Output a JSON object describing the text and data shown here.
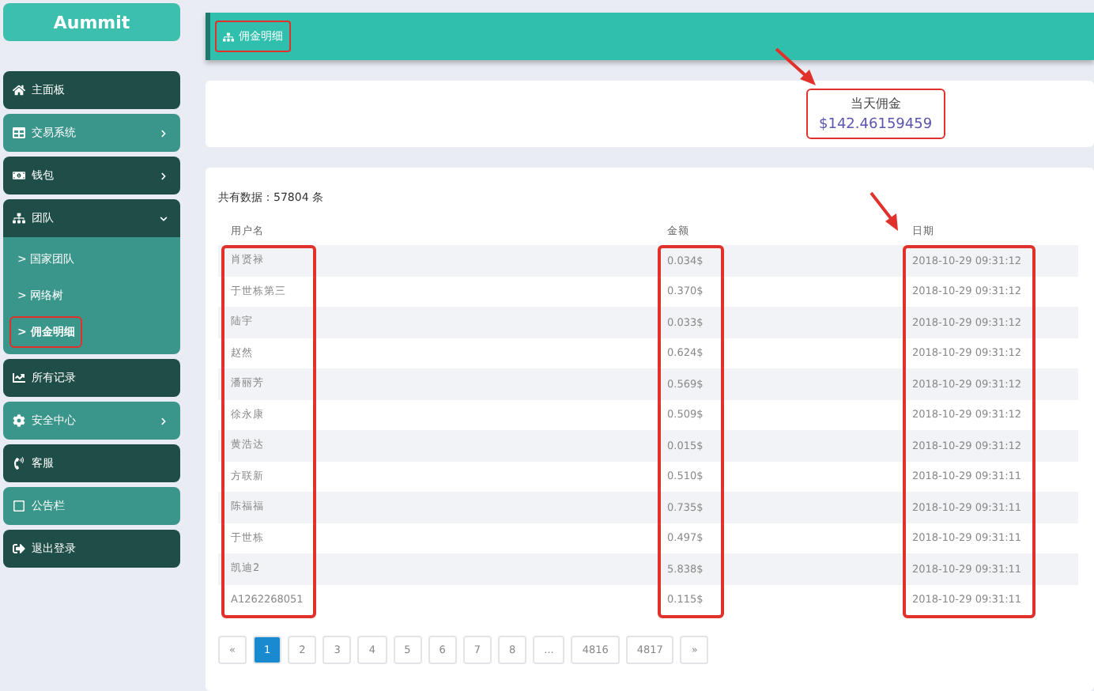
{
  "logo": "Aummit",
  "sidebar": {
    "items": [
      {
        "label": "主面板",
        "has_submenu": false,
        "expanded": false
      },
      {
        "label": "交易系统",
        "has_submenu": true,
        "expanded": false
      },
      {
        "label": "钱包",
        "has_submenu": true,
        "expanded": false
      },
      {
        "label": "团队",
        "has_submenu": true,
        "expanded": true,
        "children": [
          {
            "caret": ">",
            "label": "国家团队",
            "selected": false,
            "highlighted": false
          },
          {
            "caret": ">",
            "label": "网络树",
            "selected": false,
            "highlighted": false
          },
          {
            "caret": ">",
            "label": "佣金明细",
            "selected": true,
            "highlighted": true
          }
        ]
      },
      {
        "label": "所有记录",
        "has_submenu": false,
        "expanded": false
      },
      {
        "label": "安全中心",
        "has_submenu": true,
        "expanded": false
      },
      {
        "label": "客服",
        "has_submenu": false,
        "expanded": false
      },
      {
        "label": "公告栏",
        "has_submenu": false,
        "expanded": false
      },
      {
        "label": "退出登录",
        "has_submenu": false,
        "expanded": false
      }
    ]
  },
  "header": {
    "title": "佣金明细",
    "highlighted": true
  },
  "stat": {
    "label": "当天佣金",
    "value": "$142.46159459",
    "highlighted": true
  },
  "table": {
    "total": "共有数据：57804 条",
    "columns": [
      {
        "label": "用户名",
        "highlighted": true
      },
      {
        "label": "金额",
        "highlighted": true
      },
      {
        "label": "日期",
        "highlighted": true
      }
    ],
    "rows": [
      [
        "肖贤禄",
        "0.034$",
        "2018-10-29 09:31:12"
      ],
      [
        "于世栋第三",
        "0.370$",
        "2018-10-29 09:31:12"
      ],
      [
        "陆宇",
        "0.033$",
        "2018-10-29 09:31:12"
      ],
      [
        "赵然",
        "0.624$",
        "2018-10-29 09:31:12"
      ],
      [
        "潘丽芳",
        "0.569$",
        "2018-10-29 09:31:12"
      ],
      [
        "徐永康",
        "0.509$",
        "2018-10-29 09:31:12"
      ],
      [
        "黄浩达",
        "0.015$",
        "2018-10-29 09:31:12"
      ],
      [
        "方联新",
        "0.510$",
        "2018-10-29 09:31:11"
      ],
      [
        "陈福福",
        "0.735$",
        "2018-10-29 09:31:11"
      ],
      [
        "于世栋",
        "0.497$",
        "2018-10-29 09:31:11"
      ],
      [
        "凯迪2",
        "5.838$",
        "2018-10-29 09:31:11"
      ],
      [
        "A1262268051",
        "0.115$",
        "2018-10-29 09:31:11"
      ]
    ]
  },
  "pagination": [
    {
      "label": "«",
      "selected": false
    },
    {
      "label": "1",
      "selected": true
    },
    {
      "label": "2",
      "selected": false
    },
    {
      "label": "3",
      "selected": false
    },
    {
      "label": "4",
      "selected": false
    },
    {
      "label": "5",
      "selected": false
    },
    {
      "label": "6",
      "selected": false
    },
    {
      "label": "7",
      "selected": false
    },
    {
      "label": "8",
      "selected": false
    },
    {
      "label": "...",
      "selected": false
    },
    {
      "label": "4816",
      "selected": false
    },
    {
      "label": "4817",
      "selected": false
    },
    {
      "label": "»",
      "selected": false
    }
  ]
}
